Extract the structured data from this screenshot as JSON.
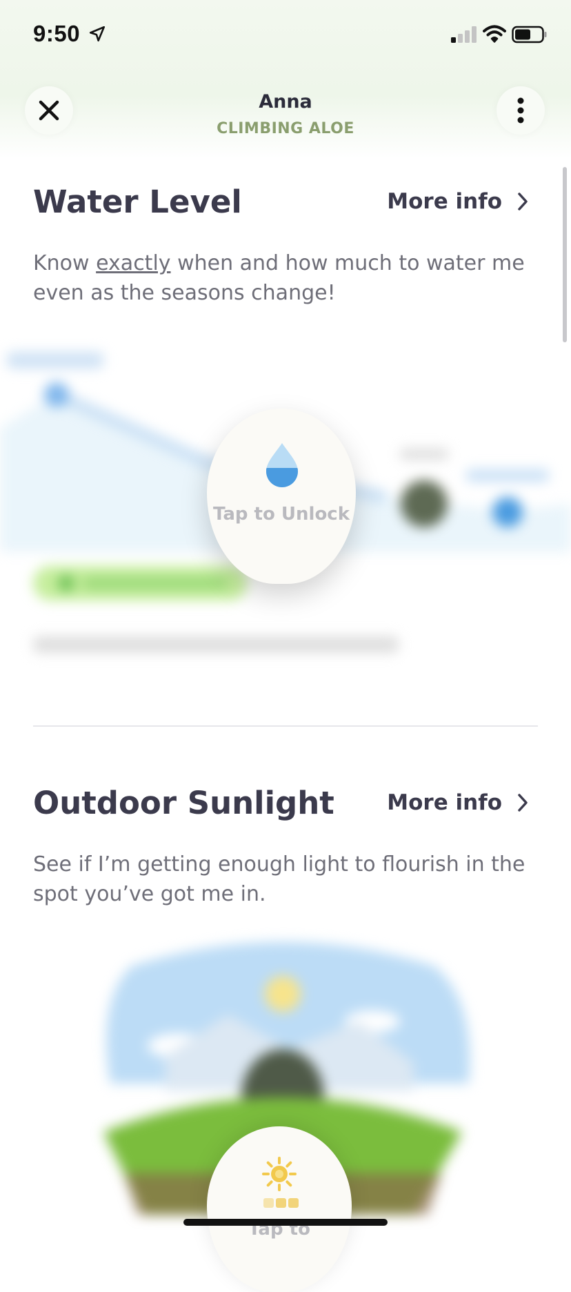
{
  "status_bar": {
    "time": "9:50"
  },
  "header": {
    "plant_name": "Anna",
    "plant_type": "CLIMBING ALOE"
  },
  "water_section": {
    "title": "Water Level",
    "more_info": "More info",
    "description_before": "Know ",
    "description_emphasis": "exactly",
    "description_after": " when and how much to water me even as the seasons change!",
    "unlock_label": "Tap to Unlock"
  },
  "sunlight_section": {
    "title": "Outdoor Sunlight",
    "more_info": "More info",
    "description": "See if I’m getting enough light to flourish in the spot you’ve got me in.",
    "unlock_label": "Tap to"
  },
  "colors": {
    "accent_green": "#8a9e6e",
    "text_dark": "#3b3a4c",
    "water_blue": "#4a9be0"
  }
}
